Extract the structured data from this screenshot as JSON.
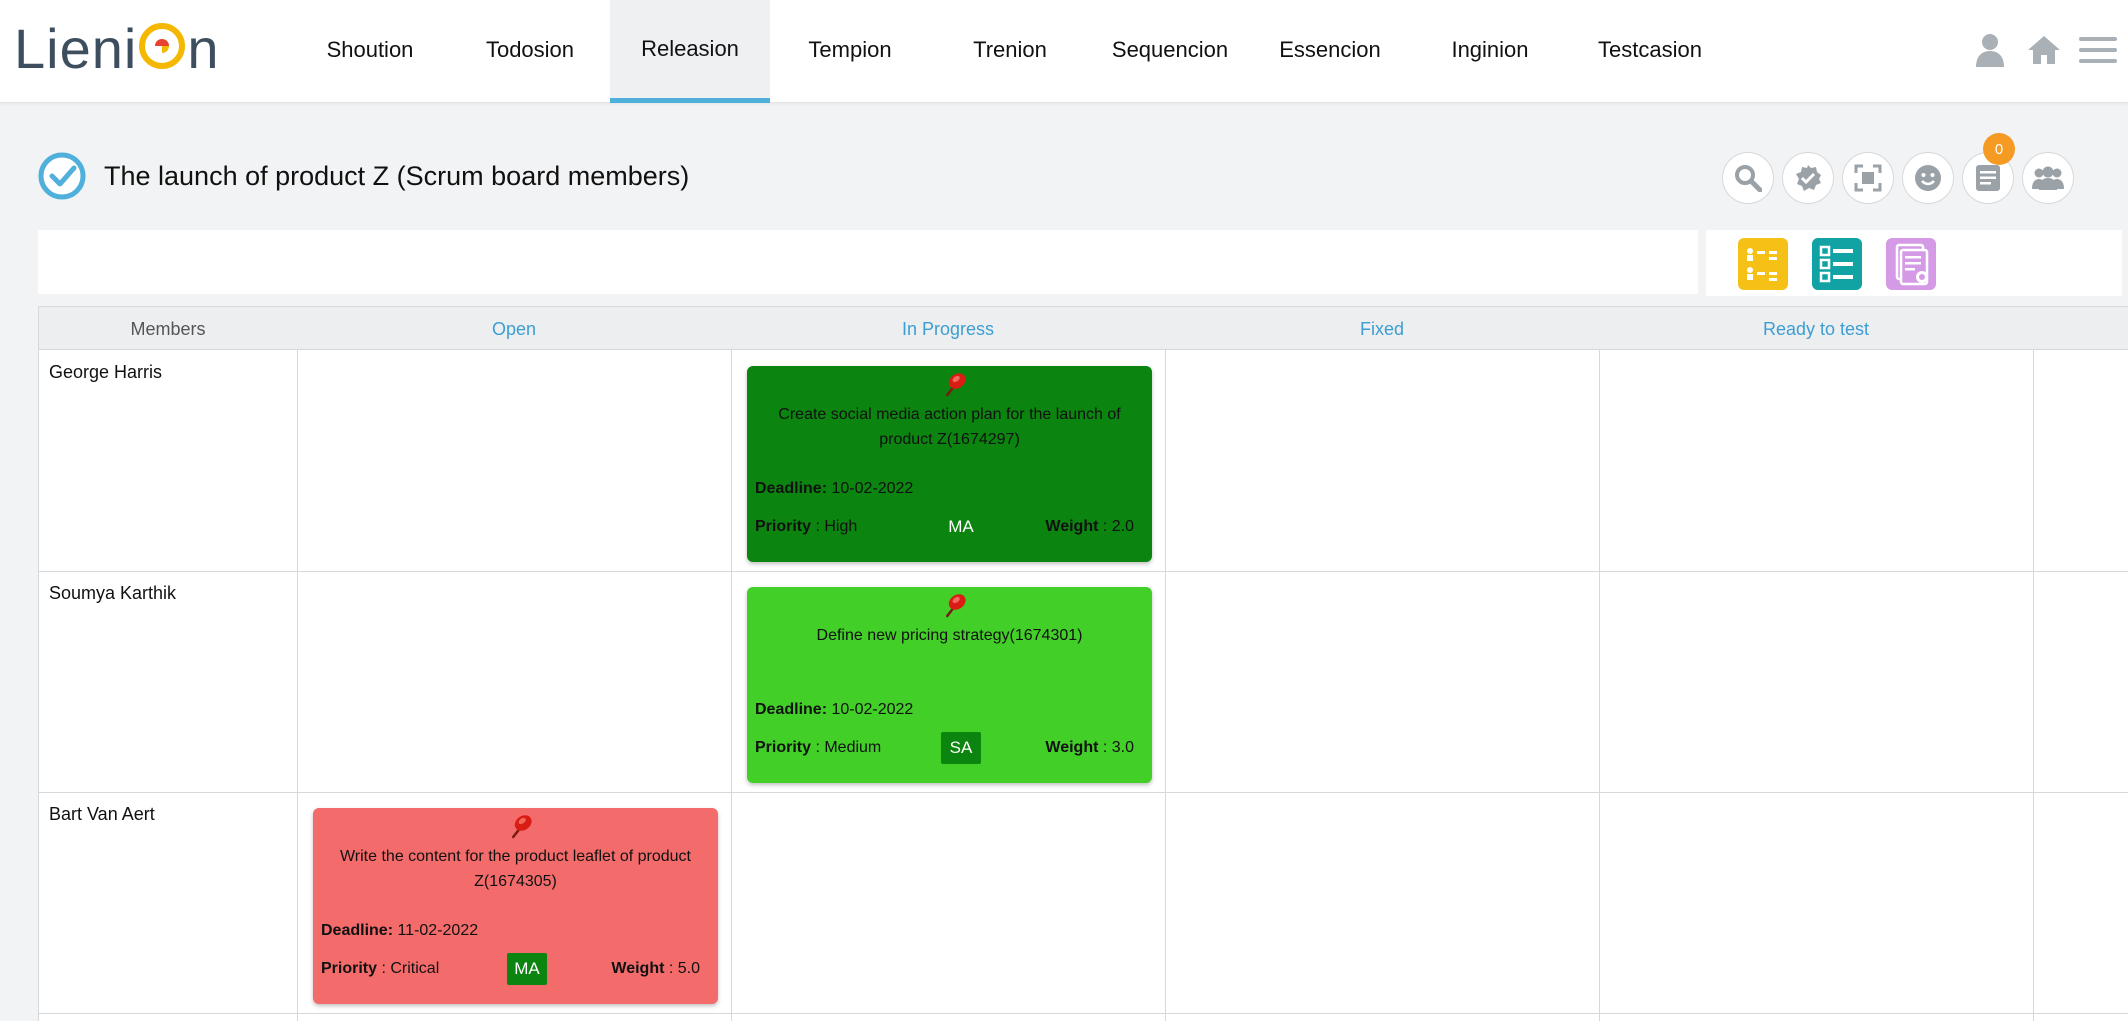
{
  "app": {
    "logo_part1": "Lieni",
    "logo_part2": "n"
  },
  "nav": {
    "items": [
      {
        "label": "Shoution",
        "active": false
      },
      {
        "label": "Todosion",
        "active": false
      },
      {
        "label": "Releasion",
        "active": true
      },
      {
        "label": "Tempion",
        "active": false
      },
      {
        "label": "Trenion",
        "active": false
      },
      {
        "label": "Sequencion",
        "active": false
      },
      {
        "label": "Essencion",
        "active": false
      },
      {
        "label": "Inginion",
        "active": false
      },
      {
        "label": "Testcasion",
        "active": false
      }
    ],
    "icons": [
      "user-icon",
      "home-icon",
      "hamburger-menu-icon"
    ]
  },
  "page": {
    "title": "The launch of product Z (Scrum board members)"
  },
  "tools": {
    "icons": [
      "search-icon",
      "approve-icon",
      "fullscreen-icon",
      "smiley-icon",
      "notes-icon",
      "team-icon"
    ],
    "notes_badge": "0"
  },
  "views": {
    "icons": [
      "board-view-icon",
      "checklist-view-icon",
      "report-view-icon"
    ],
    "colors": {
      "board": "#f5c117",
      "checklist": "#11a2a4",
      "report": "#d59ae6"
    }
  },
  "board": {
    "columns": {
      "members": "Members",
      "open": "Open",
      "in_progress": "In Progress",
      "fixed": "Fixed",
      "ready_to_test": "Ready to test"
    },
    "members": [
      "George Harris",
      "Soumya Karthik",
      "Bart Van Aert"
    ],
    "cards": [
      {
        "title": "Create social media action plan for the launch of product Z(1674297)",
        "deadline_label": "Deadline:",
        "deadline": "10-02-2022",
        "priority_label": "Priority",
        "priority": " : High",
        "owner": "MA",
        "weight_label": "Weight",
        "weight": " : 2.0",
        "color": "#0b8410"
      },
      {
        "title": "Define new pricing strategy(1674301)",
        "deadline_label": "Deadline:",
        "deadline": "10-02-2022",
        "priority_label": "Priority",
        "priority": " : Medium",
        "owner": "SA",
        "weight_label": "Weight",
        "weight": " : 3.0",
        "color": "#42cf28"
      },
      {
        "title": "Write the content for the product leaflet of product Z(1674305)",
        "deadline_label": "Deadline:",
        "deadline": "11-02-2022",
        "priority_label": "Priority",
        "priority": " : Critical",
        "owner": "MA",
        "weight_label": "Weight",
        "weight": " : 5.0",
        "color": "#f46b6b"
      }
    ]
  },
  "colors": {
    "accent": "#4fb0dc",
    "column_header": "#3c9ed3",
    "badge": "#f59a23",
    "owner_chip": "#0b8410"
  }
}
